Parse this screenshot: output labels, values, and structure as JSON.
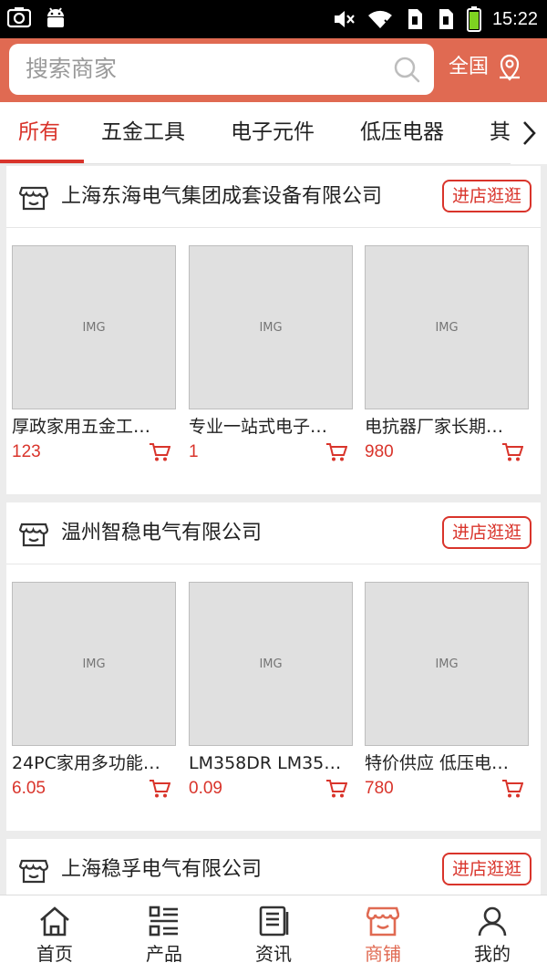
{
  "status_bar": {
    "time": "15:22"
  },
  "header": {
    "search_placeholder": "搜索商家",
    "region_label": "全国"
  },
  "tabs": [
    {
      "label": "所有",
      "active": true
    },
    {
      "label": "五金工具"
    },
    {
      "label": "电子元件"
    },
    {
      "label": "低压电器"
    },
    {
      "label": "其"
    }
  ],
  "visit_label": "进店逛逛",
  "shops": [
    {
      "name": "上海东海电气集团成套设备有限公司",
      "products": [
        {
          "name": "厚政家用五金工…",
          "price": "123"
        },
        {
          "name": "专业一站式电子…",
          "price": "1"
        },
        {
          "name": "电抗器厂家长期…",
          "price": "980"
        }
      ]
    },
    {
      "name": "温州智稳电气有限公司",
      "products": [
        {
          "name": "24PC家用多功能…",
          "price": "6.05"
        },
        {
          "name": "LM358DR LM35…",
          "price": "0.09"
        },
        {
          "name": "特价供应 低压电…",
          "price": "780"
        }
      ]
    },
    {
      "name": "上海稳孚电气有限公司",
      "products": []
    }
  ],
  "bottom_nav": [
    {
      "label": "首页",
      "icon": "home-icon"
    },
    {
      "label": "产品",
      "icon": "product-list-icon"
    },
    {
      "label": "资讯",
      "icon": "news-icon"
    },
    {
      "label": "商铺",
      "icon": "shop-icon",
      "active": true
    },
    {
      "label": "我的",
      "icon": "user-icon"
    }
  ],
  "colors": {
    "header": "#e06a52",
    "accent": "#d9342b",
    "background": "#ececec"
  }
}
